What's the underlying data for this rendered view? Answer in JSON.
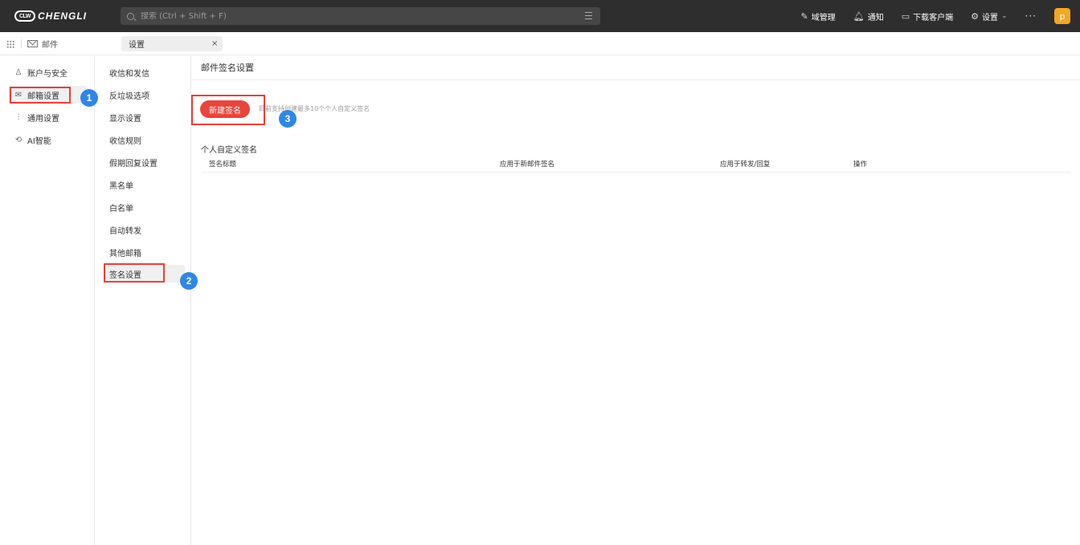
{
  "app": {
    "logo_mark": "CLW",
    "logo_text": "CHENGLI"
  },
  "search": {
    "placeholder": "搜索 (Ctrl + Shift + F)"
  },
  "top_actions": {
    "domain_manage": "域管理",
    "notify": "通知",
    "download_client": "下载客户端",
    "settings": "设置",
    "more": "···",
    "avatar_letter": "p"
  },
  "tabs": {
    "mail": "邮件",
    "settings": "设置",
    "close": "×"
  },
  "nav_primary": [
    {
      "label": "账户与安全",
      "icon": "user-icon"
    },
    {
      "label": "邮箱设置",
      "icon": "mailbox-icon"
    },
    {
      "label": "通用设置",
      "icon": "sliders-icon"
    },
    {
      "label": "AI智能",
      "icon": "ai-icon"
    }
  ],
  "nav_secondary": [
    "收信和发信",
    "反垃圾选项",
    "显示设置",
    "收信规则",
    "假期回复设置",
    "黑名单",
    "白名单",
    "自动转发",
    "其他邮箱",
    "签名设置"
  ],
  "main": {
    "title": "邮件签名设置",
    "new_button": "新建签名",
    "hint": "目前支持创建最多10个个人自定义签名",
    "section_title": "个人自定义签名",
    "columns": [
      "签名标题",
      "应用于新邮件签名",
      "应用于转发/回复",
      "操作"
    ]
  },
  "annotations": {
    "badge_1": "1",
    "badge_2": "2",
    "badge_3": "3"
  },
  "colors": {
    "accent_red": "#e8453c",
    "badge_blue": "#2f86e6",
    "avatar": "#f5a623",
    "topbar": "#2e2e2e"
  }
}
